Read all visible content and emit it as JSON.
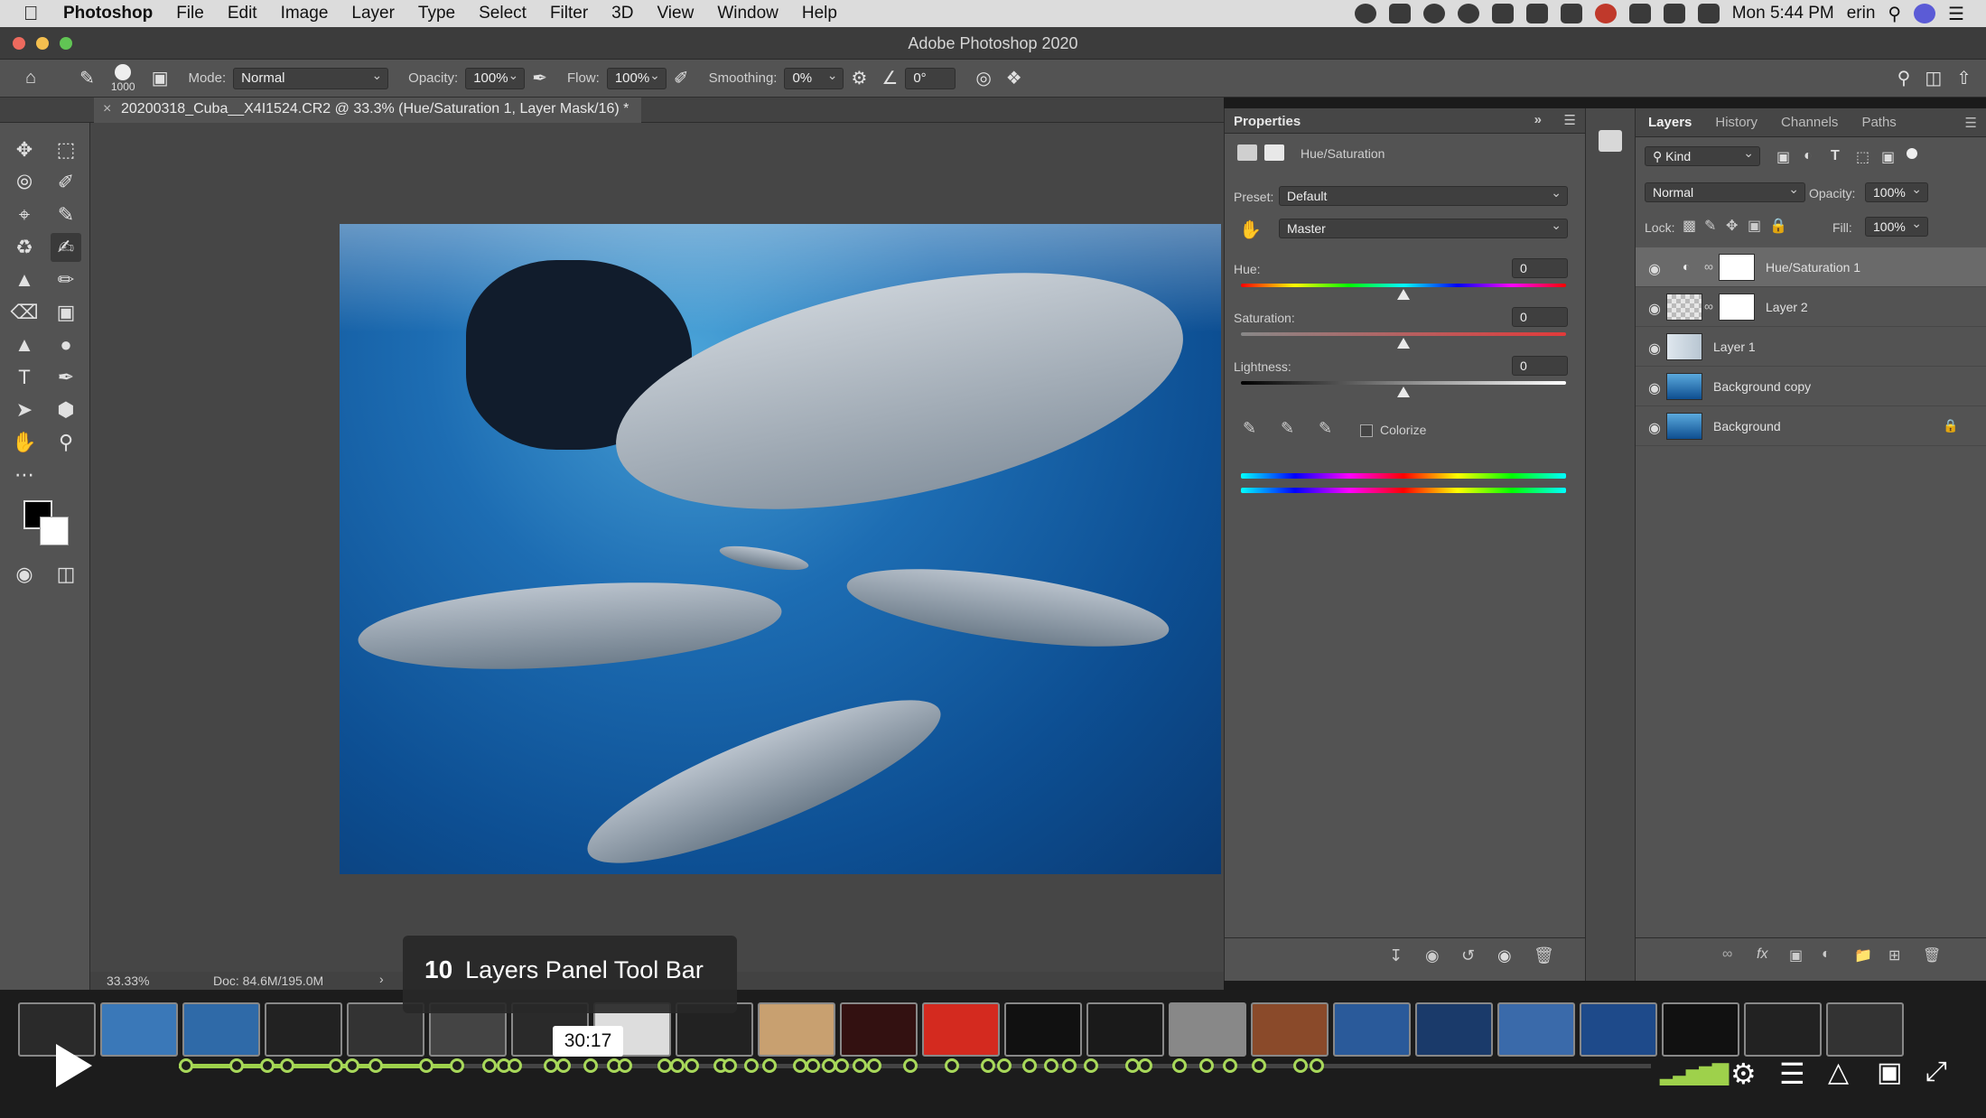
{
  "menubar": {
    "app": "Photoshop",
    "items": [
      "File",
      "Edit",
      "Image",
      "Layer",
      "Type",
      "Select",
      "Filter",
      "3D",
      "View",
      "Window",
      "Help"
    ],
    "clock": "Mon 5:44 PM",
    "user": "erin"
  },
  "window": {
    "title": "Adobe Photoshop 2020"
  },
  "options": {
    "brush_size": "1000",
    "mode_label": "Mode:",
    "mode_value": "Normal",
    "opacity_label": "Opacity:",
    "opacity_value": "100%",
    "flow_label": "Flow:",
    "flow_value": "100%",
    "smoothing_label": "Smoothing:",
    "smoothing_value": "0%",
    "angle_value": "0°"
  },
  "document": {
    "tab_title": "20200318_Cuba__X4I1524.CR2 @ 33.3% (Hue/Saturation 1, Layer Mask/16) *",
    "zoom": "33.33%",
    "doc_size": "Doc: 84.6M/195.0M"
  },
  "properties": {
    "panel_title": "Properties",
    "adjustment_name": "Hue/Saturation",
    "preset_label": "Preset:",
    "preset_value": "Default",
    "channel_value": "Master",
    "hue_label": "Hue:",
    "hue_value": "0",
    "saturation_label": "Saturation:",
    "saturation_value": "0",
    "lightness_label": "Lightness:",
    "lightness_value": "0",
    "colorize_label": "Colorize"
  },
  "layers_panel": {
    "tabs": [
      "Layers",
      "History",
      "Channels",
      "Paths"
    ],
    "kind_label": "Kind",
    "blend_mode": "Normal",
    "opacity_label": "Opacity:",
    "opacity_value": "100%",
    "lock_label": "Lock:",
    "fill_label": "Fill:",
    "fill_value": "100%",
    "layers": [
      {
        "name": "Hue/Saturation 1"
      },
      {
        "name": "Layer 2"
      },
      {
        "name": "Layer 1"
      },
      {
        "name": "Background copy"
      },
      {
        "name": "Background"
      }
    ]
  },
  "player": {
    "chapter_number": "10",
    "chapter_title": "Layers Panel Tool Bar",
    "time": "30:17",
    "progress": 0.19
  },
  "colors": {
    "accent_green": "#9ed14b",
    "ps_panel": "#535353",
    "ps_dark": "#464646"
  }
}
